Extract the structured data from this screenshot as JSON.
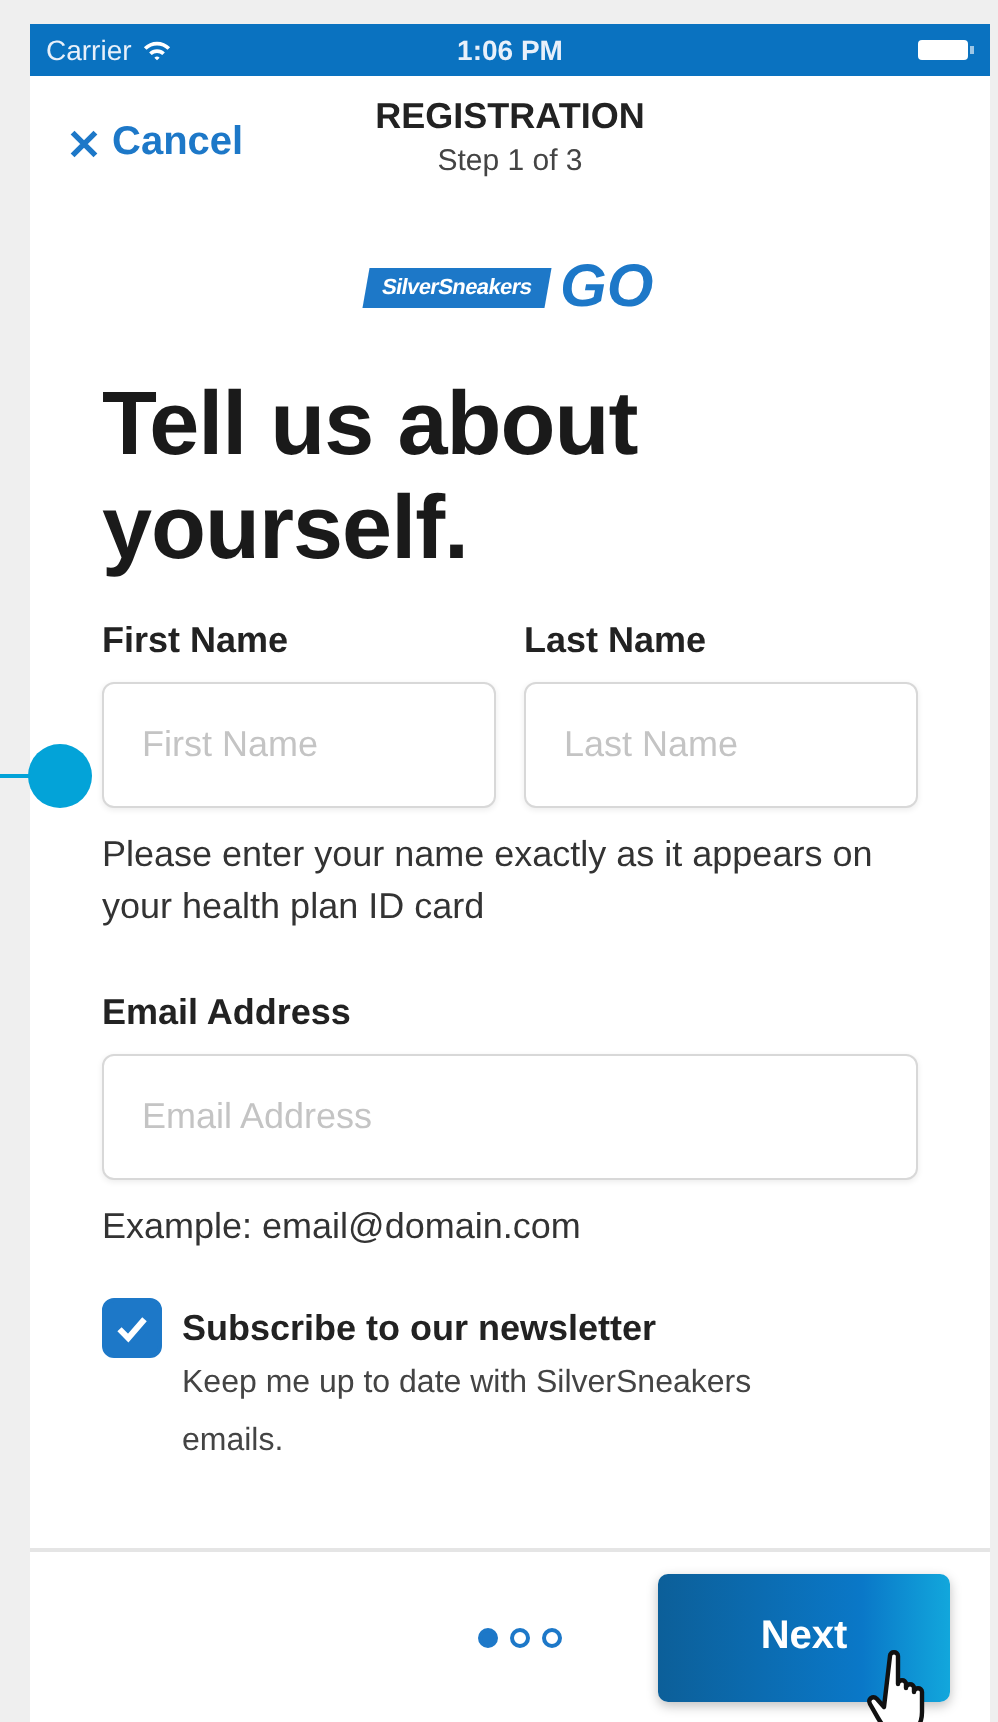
{
  "status_bar": {
    "carrier": "Carrier",
    "time": "1:06 PM"
  },
  "header": {
    "cancel": "Cancel",
    "title": "REGISTRATION",
    "subtitle": "Step 1 of 3"
  },
  "logo": {
    "brand": "SilverSneakers",
    "mark": "GO"
  },
  "heading": "Tell us about yourself.",
  "name_fields": [
    {
      "label": "First Name",
      "placeholder": "First Name"
    },
    {
      "label": "Last Name",
      "placeholder": "Last Name"
    }
  ],
  "name_help": "Please enter your name exactly as it appears on your health plan ID card",
  "email_field": {
    "label": "Email Address",
    "placeholder": "Email Address"
  },
  "email_help": "Example: email@domain.com",
  "newsletter": {
    "label": "Subscribe to our newsletter",
    "description": "Keep me up to date with SilverSneakers emails.",
    "checked": true
  },
  "pager": [
    {
      "selected": true
    },
    {
      "selected": false
    },
    {
      "selected": false
    }
  ],
  "next_button": "Next"
}
